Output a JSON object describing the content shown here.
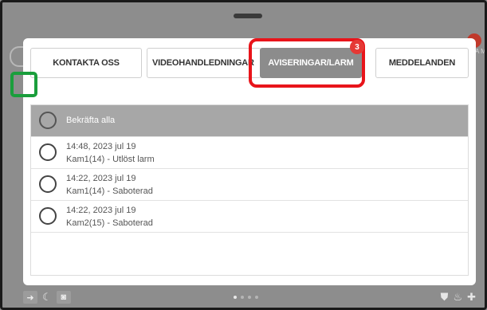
{
  "tabs": [
    {
      "label": "KONTAKTA OSS"
    },
    {
      "label": "VIDEOHANDLEDNINGAR"
    },
    {
      "label": "AVISERINGAR/LARM"
    },
    {
      "label": "MEDDELANDEN"
    }
  ],
  "notifications_badge": "3",
  "confirm_all_label": "Bekräfta alla",
  "notifications": [
    {
      "time": "14:48, 2023 jul 19",
      "description": "Kam1(14) - Utlöst larm"
    },
    {
      "time": "14:22, 2023 jul 19",
      "description": "Kam1(14) - Saboterad"
    },
    {
      "time": "14:22, 2023 jul 19",
      "description": "Kam2(15) - Saboterad"
    }
  ],
  "background": {
    "side_text": "A M"
  },
  "colors": {
    "active_tab": "#8c8c8c",
    "badge": "#e53935",
    "highlight_red": "#e8141a",
    "highlight_green": "#1a9e3c"
  },
  "icons": {
    "bottom_left": [
      "exit-arrow-icon",
      "moon-icon",
      "camera-icon"
    ],
    "bottom_right": [
      "shield-icon",
      "fire-icon",
      "medical-cross-icon"
    ]
  },
  "pager": {
    "pages": 4,
    "current": 0
  }
}
